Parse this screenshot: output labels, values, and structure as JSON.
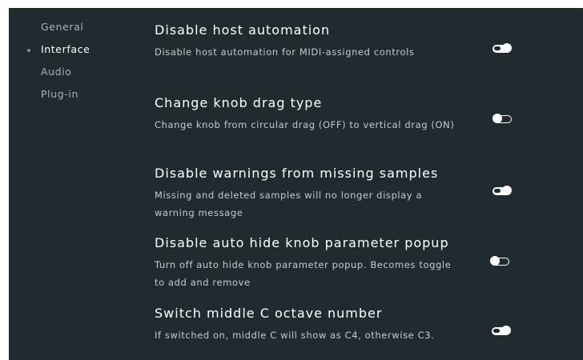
{
  "sidebar": {
    "items": [
      {
        "label": "General",
        "active": false
      },
      {
        "label": "Interface",
        "active": true
      },
      {
        "label": "Audio",
        "active": false
      },
      {
        "label": "Plug-in",
        "active": false
      }
    ]
  },
  "settings": [
    {
      "title": "Disable host automation",
      "desc": "Disable host automation for MIDI-assigned controls",
      "enabled": true
    },
    {
      "title": "Change knob drag type",
      "desc": "Change knob from circular drag (OFF) to vertical drag (ON)",
      "enabled": false
    },
    {
      "title": "Disable warnings from missing samples",
      "desc": "Missing and deleted samples will no longer display a warning message",
      "enabled": true
    },
    {
      "title": "Disable auto hide knob parameter popup",
      "desc": "Turn off auto hide knob parameter popup. Becomes toggle to add and remove",
      "enabled": false
    },
    {
      "title": "Switch middle C octave number",
      "desc": "If switched on, middle C will show as C4, otherwise C3.",
      "enabled": true
    }
  ],
  "colors": {
    "panel_bg": "#1f2b2f",
    "text": "#ffffff",
    "muted": "#aab3b6"
  }
}
